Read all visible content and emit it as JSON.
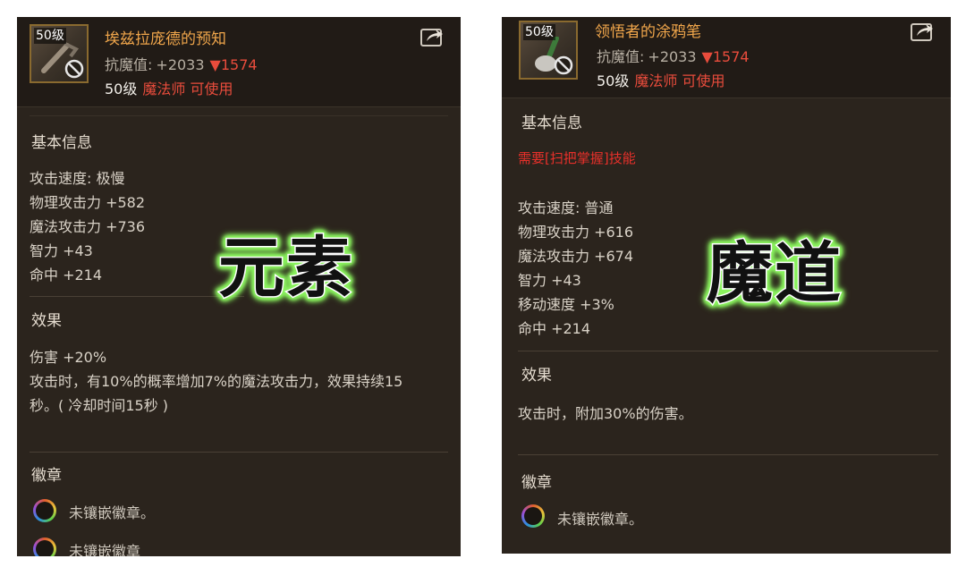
{
  "left_item": {
    "level_badge": "50级",
    "name": "埃兹拉庞德的预知",
    "resist_label": "抗魔值:",
    "resist_value": "+2033",
    "resist_down": "▼1574",
    "req_level": "50级",
    "req_class": "魔法师 可使用",
    "basic_info_title": "基本信息",
    "stats": [
      "攻击速度: 极慢",
      "物理攻击力 +582",
      "魔法攻击力 +736",
      "智力 +43",
      "命中 +214"
    ],
    "effect_title": "效果",
    "effects": [
      "伤害 +20%",
      "攻击时，有10%的概率增加7%的魔法攻击力，效果持续15",
      "秒。( 冷却时间15秒 )"
    ],
    "emblem_title": "徽章",
    "emblems": [
      "未镶嵌徽章。",
      "未镶嵌徽章"
    ],
    "overlay": "元素"
  },
  "right_item": {
    "level_badge": "50级",
    "name": "领悟者的涂鸦笔",
    "resist_label": "抗魔值:",
    "resist_value": "+2033",
    "resist_down": "▼1574",
    "req_level": "50级",
    "req_class": "魔法师 可使用",
    "basic_info_title": "基本信息",
    "warning": "需要[扫把掌握]技能",
    "stats": [
      "攻击速度: 普通",
      "物理攻击力 +616",
      "魔法攻击力 +674",
      "智力 +43",
      "移动速度 +3%",
      "命中 +214"
    ],
    "effect_title": "效果",
    "effects": [
      "攻击时，附加30%的伤害。"
    ],
    "emblem_title": "徽章",
    "emblems": [
      "未镶嵌徽章。"
    ],
    "overlay": "魔道"
  },
  "colors": {
    "panel_bg": "#2b241d",
    "item_name": "#f0a64b",
    "resist_down": "#e94c3c",
    "warning": "#e8302a",
    "overlay_glow": "#8af25e"
  },
  "icons": [
    "prohibited-icon",
    "share-icon",
    "emblem-slot-icon"
  ]
}
